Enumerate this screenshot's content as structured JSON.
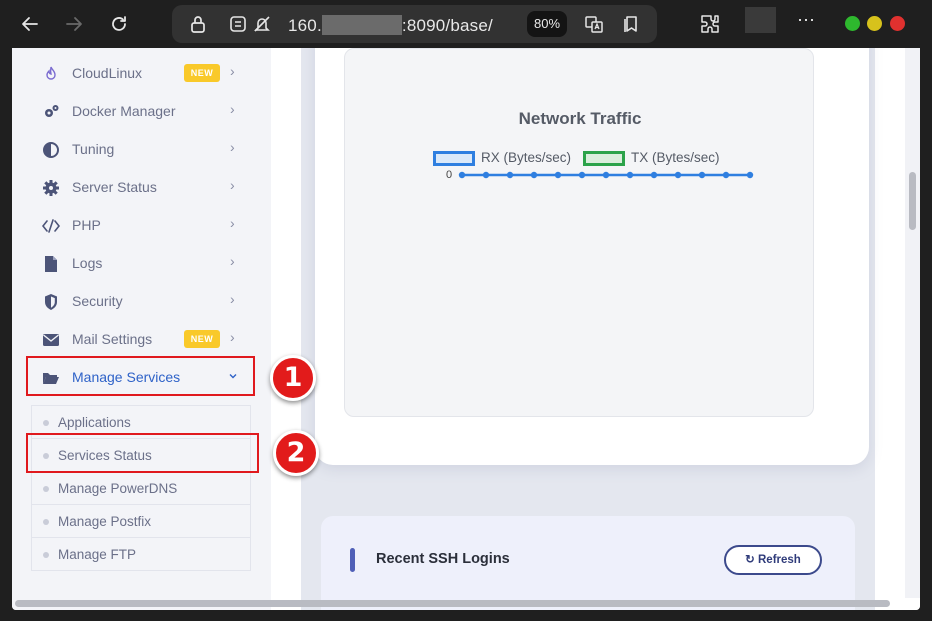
{
  "browser": {
    "url_prefix": "160.",
    "url_suffix": ":8090/base/",
    "zoom": "80%"
  },
  "sidebar": {
    "items": [
      {
        "label": "CloudLinux",
        "badge": "NEW",
        "icon": "flame-icon"
      },
      {
        "label": "Docker Manager",
        "icon": "cogs-icon"
      },
      {
        "label": "Tuning",
        "icon": "half-circle-icon"
      },
      {
        "label": "Server Status",
        "icon": "gear-icon"
      },
      {
        "label": "PHP",
        "icon": "code-icon"
      },
      {
        "label": "Logs",
        "icon": "file-icon"
      },
      {
        "label": "Security",
        "icon": "shield-icon"
      },
      {
        "label": "Mail Settings",
        "badge": "NEW",
        "icon": "envelope-icon"
      },
      {
        "label": "Manage Services",
        "icon": "folder-open-icon"
      }
    ],
    "submenu": [
      {
        "label": "Applications"
      },
      {
        "label": "Services Status"
      },
      {
        "label": "Manage PowerDNS"
      },
      {
        "label": "Manage Postfix"
      },
      {
        "label": "Manage FTP"
      }
    ]
  },
  "annotations": {
    "step1": "1",
    "step2": "2"
  },
  "traffic": {
    "title": "Network Traffic",
    "zero": "0",
    "legend": [
      {
        "label": "RX (Bytes/sec)",
        "color": "#2f7fe0"
      },
      {
        "label": "TX (Bytes/sec)",
        "color": "#2ca34a"
      }
    ]
  },
  "ssh": {
    "title": "Recent SSH Logins",
    "refresh_label": "Refresh",
    "refresh_icon": "↻"
  }
}
